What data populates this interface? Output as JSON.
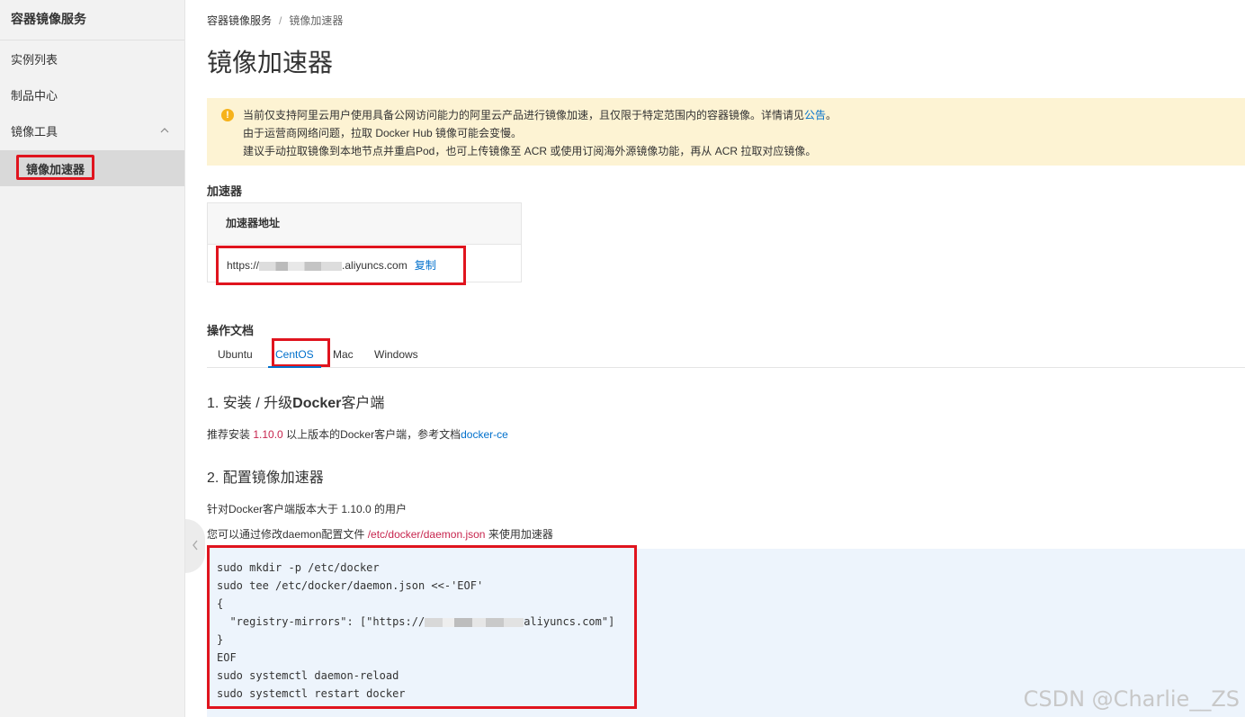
{
  "sidebar": {
    "title": "容器镜像服务",
    "items": [
      {
        "label": "实例列表"
      },
      {
        "label": "制品中心"
      },
      {
        "label": "镜像工具"
      }
    ],
    "active_sub": "镜像加速器"
  },
  "breadcrumb": {
    "root": "容器镜像服务",
    "separator": "/",
    "current": "镜像加速器"
  },
  "page_title": "镜像加速器",
  "notice": {
    "line1_text": "当前仅支持阿里云用户使用具备公网访问能力的阿里云产品进行镜像加速，且仅限于特定范围内的容器镜像。详情请见",
    "line1_link": "公告",
    "line1_end": "。",
    "line2": "由于运营商网络问题，拉取 Docker Hub 镜像可能会变慢。",
    "line3": "建议手动拉取镜像到本地节点并重启Pod，也可上传镜像至 ACR 或使用订阅海外源镜像功能，再从 ACR 拉取对应镜像。"
  },
  "accelerator": {
    "section_title": "加速器",
    "column_header": "加速器地址",
    "url_prefix": "https://",
    "url_suffix": ".aliyuncs.com",
    "copy_label": "复制"
  },
  "docs": {
    "section_title": "操作文档",
    "tabs": [
      "Ubuntu",
      "CentOS",
      "Mac",
      "Windows"
    ],
    "active_tab": "CentOS",
    "step1_num": "1.",
    "step1_title_a": "安装 / 升级",
    "step1_title_b": "Docker",
    "step1_title_c": "客户端",
    "step1_text_a": "推荐安装",
    "step1_version": "1.10.0",
    "step1_text_b": "以上版本的Docker客户端，参考文档",
    "step1_link": "docker-ce",
    "step2_title": "2. 配置镜像加速器",
    "step2_text1": "针对Docker客户端版本大于 1.10.0 的用户",
    "step2_text2_a": "您可以通过修改daemon配置文件",
    "step2_path": "/etc/docker/daemon.json",
    "step2_text2_b": "来使用加速器"
  },
  "code": {
    "line1": "sudo mkdir -p /etc/docker",
    "line2": "sudo tee /etc/docker/daemon.json <<-'EOF'",
    "line3": "{",
    "line4_prefix": "  \"registry-mirrors\": [\"https://",
    "line4_suffix": "aliyuncs.com\"]",
    "line5": "}",
    "line6": "EOF",
    "line7": "sudo systemctl daemon-reload",
    "line8": "sudo systemctl restart docker"
  },
  "watermark": "CSDN @Charlie__ZS"
}
